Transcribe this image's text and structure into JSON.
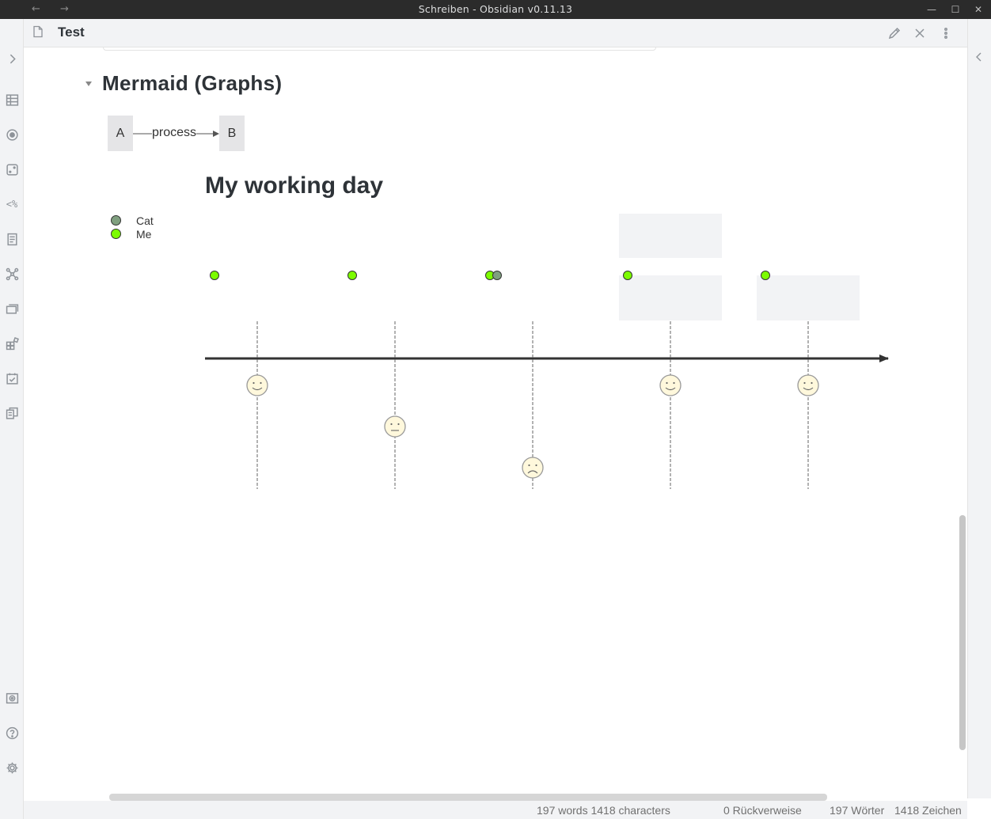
{
  "window": {
    "title": "Schreiben - Obsidian v0.11.13",
    "back_glyph": "←",
    "forward_glyph": "→",
    "minimize_glyph": "—",
    "maximize_glyph": "☐",
    "close_glyph": "✕"
  },
  "ribbon": {
    "top_icons": [
      "table-icon",
      "graph-focus-icon",
      "dice-icon",
      "template-icon",
      "page-preview-icon",
      "graph-view-icon",
      "slides-icon",
      "plugins-icon",
      "daily-note-icon",
      "copy-note-icon"
    ],
    "bottom_icons": [
      "vault-icon",
      "help-icon",
      "settings-icon"
    ]
  },
  "view": {
    "title": "Test"
  },
  "note": {
    "heading": "Mermaid (Graphs)",
    "flowchart": {
      "node_a": "A",
      "node_b": "B",
      "edge_label": "process"
    },
    "journey": {
      "title": "My working day",
      "actors": [
        {
          "name": "Cat",
          "color": "#7f9f7f"
        },
        {
          "name": "Me",
          "color": "#7cfc00"
        }
      ],
      "tasks": [
        {
          "score": 5,
          "actors": [
            "Me"
          ]
        },
        {
          "score": 3,
          "actors": [
            "Me"
          ]
        },
        {
          "score": 1,
          "actors": [
            "Me",
            "Cat"
          ]
        },
        {
          "score": 5,
          "actors": [
            "Me"
          ]
        },
        {
          "score": 5,
          "actors": [
            "Me"
          ]
        }
      ]
    }
  },
  "status": {
    "words_chars": "197 words 1418 characters",
    "backlinks": "0 Rückverweise",
    "words_de": "197 Wörter",
    "chars_de": "1418 Zeichen"
  },
  "colors": {
    "accent": "#7cfc00",
    "face_fill": "#fff8dc",
    "background": "#f2f3f5"
  }
}
